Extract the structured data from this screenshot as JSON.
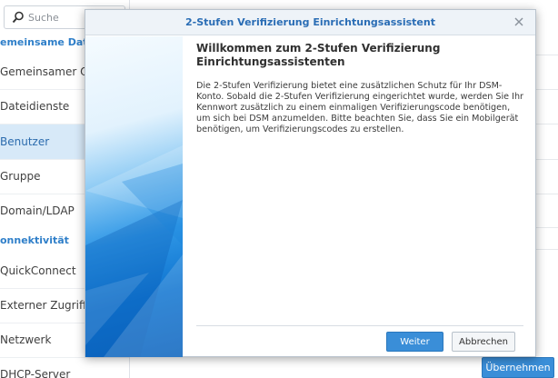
{
  "sidebar": {
    "search_placeholder": "Suche",
    "sections": [
      {
        "label": "emeinsame Dateie"
      },
      {
        "label": "onnektivität"
      }
    ],
    "items": [
      {
        "label": "Gemeinsamer Or"
      },
      {
        "label": "Dateidienste"
      },
      {
        "label": "Benutzer"
      },
      {
        "label": "Gruppe"
      },
      {
        "label": "Domain/LDAP"
      },
      {
        "label": "QuickConnect"
      },
      {
        "label": "Externer Zugriff"
      },
      {
        "label": "Netzwerk"
      },
      {
        "label": "DHCP-Server"
      }
    ]
  },
  "apply_label": "Übernehmen",
  "dialog": {
    "title": "2-Stufen Verifizierung Einrichtungsassistent",
    "heading": "Willkommen zum 2-Stufen Verifizierung Einrichtungsassistenten",
    "body": "Die 2-Stufen Verifizierung bietet eine zusätzlichen Schutz für Ihr DSM-Konto. Sobald die 2-Stufen Verifizierung eingerichtet wurde, werden Sie Ihr Kennwort zusätzlich zu einem einmaligen Verifizierungscode benötigen, um sich bei DSM anzumelden. Bitte beachten Sie, dass Sie ein Mobilgerät benötigen, um Verifizierungscodes zu erstellen.",
    "next_label": "Weiter",
    "cancel_label": "Abbrechen"
  },
  "colors": {
    "accent": "#3a8ed8",
    "title": "#2a6db5",
    "selected_bg": "#d7e9f8"
  }
}
